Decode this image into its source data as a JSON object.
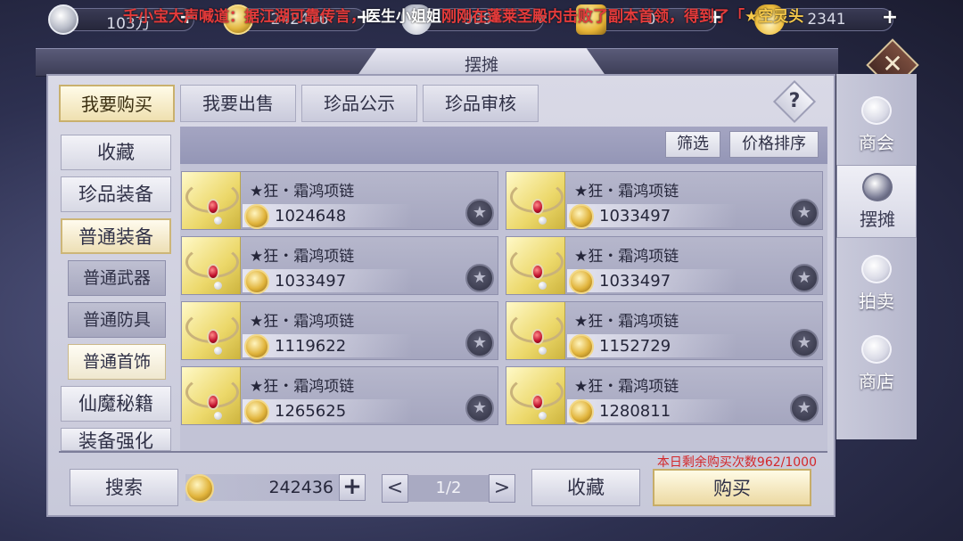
{
  "currencies": [
    {
      "icon": "silver-coin-icon",
      "value": "103万"
    },
    {
      "icon": "gold-coin-icon",
      "value": "242436"
    },
    {
      "icon": "silver-ingot-icon",
      "value": "999"
    },
    {
      "icon": "locked-gold-icon",
      "value": "0"
    },
    {
      "icon": "gold-ingot-icon",
      "value": "2341"
    }
  ],
  "marquee": {
    "part1": "千小宝大声喊道：据江湖可靠传言，",
    "part2": "医生小姐姐",
    "part3": "刚刚在蓬莱圣殿内击败了副本首领，得到了「",
    "part4": "★空灵头"
  },
  "window": {
    "title": "摆摊"
  },
  "tabs": [
    {
      "label": "我要购买",
      "active": true
    },
    {
      "label": "我要出售",
      "active": false
    },
    {
      "label": "珍品公示",
      "active": false
    },
    {
      "label": "珍品审核",
      "active": false
    }
  ],
  "help_label": "?",
  "categories": {
    "favorites": "收藏",
    "rare_equipment": "珍品装备",
    "normal_equipment": "普通装备",
    "sub": [
      {
        "label": "普通武器"
      },
      {
        "label": "普通防具"
      },
      {
        "label": "普通首饰"
      }
    ],
    "cultivation_books": "仙魔秘籍",
    "enhance": "装备强化"
  },
  "filters": {
    "filter": "筛选",
    "sort": "价格排序"
  },
  "items": [
    {
      "name": "★狂・霜鸿项链",
      "price": "1024648"
    },
    {
      "name": "★狂・霜鸿项链",
      "price": "1033497"
    },
    {
      "name": "★狂・霜鸿项链",
      "price": "1033497"
    },
    {
      "name": "★狂・霜鸿项链",
      "price": "1033497"
    },
    {
      "name": "★狂・霜鸿项链",
      "price": "1119622"
    },
    {
      "name": "★狂・霜鸿项链",
      "price": "1152729"
    },
    {
      "name": "★狂・霜鸿项链",
      "price": "1265625"
    },
    {
      "name": "★狂・霜鸿项链",
      "price": "1280811"
    }
  ],
  "star_glyph": "★",
  "bottom": {
    "search": "搜索",
    "money": "242436",
    "plus": "+",
    "prev": "<",
    "next": ">",
    "page": "1/2",
    "favorite": "收藏",
    "buy": "购买",
    "remaining": "本日剩余购买次数962/1000"
  },
  "close_glyph": "✕",
  "right_nav": [
    {
      "label": "商会",
      "icon": "chamber-of-commerce-icon",
      "active": false
    },
    {
      "label": "摆摊",
      "icon": "stall-bag-icon",
      "active": true
    },
    {
      "label": "拍卖",
      "icon": "auction-gavel-icon",
      "active": false
    },
    {
      "label": "商店",
      "icon": "shop-ingot-icon",
      "active": false
    }
  ]
}
